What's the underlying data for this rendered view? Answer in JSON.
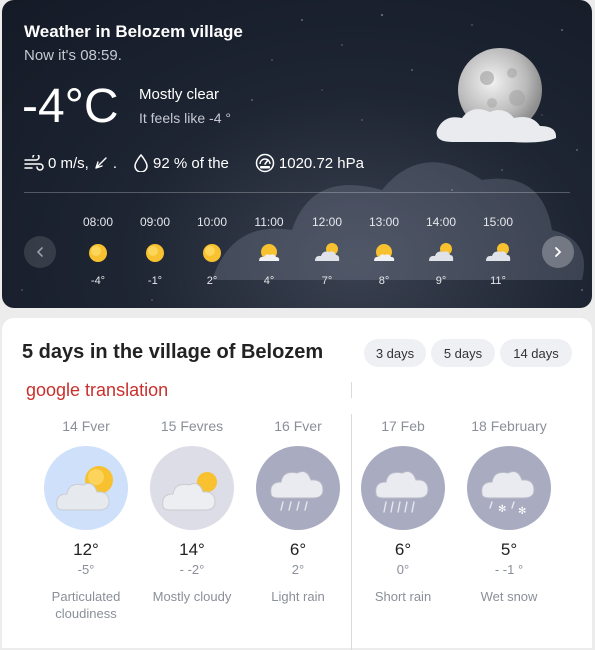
{
  "current": {
    "title": "Weather in Belozem village",
    "time": "Now it's 08:59.",
    "temperature": "-4°C",
    "condition": "Mostly clear",
    "feels_like": "It feels like -4 °",
    "condition_icon": "moon-with-cloud-icon",
    "metrics": {
      "wind": {
        "icon": "wind-icon",
        "value": "0 m/s,",
        "direction_icon": "wind-direction-icon",
        "suffix": "."
      },
      "humidity": {
        "icon": "humidity-icon",
        "value": "92 % of the"
      },
      "pressure": {
        "icon": "pressure-gauge-icon",
        "value": "1020.72 hPa"
      }
    }
  },
  "hourly": [
    {
      "time": "08:00",
      "icon": "sun-icon",
      "temp": "-4°"
    },
    {
      "time": "09:00",
      "icon": "sun-icon",
      "temp": "-1°"
    },
    {
      "time": "10:00",
      "icon": "sun-icon",
      "temp": "2°"
    },
    {
      "time": "11:00",
      "icon": "sun-behind-small-cloud-icon",
      "temp": "4°"
    },
    {
      "time": "12:00",
      "icon": "sun-behind-cloud-icon",
      "temp": "7°"
    },
    {
      "time": "13:00",
      "icon": "sun-behind-small-cloud-icon",
      "temp": "8°"
    },
    {
      "time": "14:00",
      "icon": "sun-behind-cloud-icon",
      "temp": "9°"
    },
    {
      "time": "15:00",
      "icon": "sun-behind-cloud-icon",
      "temp": "11°"
    }
  ],
  "forecast": {
    "title": "5 days in the village of Belozem",
    "ranges": [
      "3 days",
      "5 days",
      "14 days"
    ],
    "translation_note": "google translation",
    "days": [
      {
        "date": "14 Fver",
        "max": "12°",
        "min": "-5°",
        "condition": "Particulated cloudiness",
        "icon": "partly-cloudy-icon"
      },
      {
        "date": "15 Fevres",
        "max": "14°",
        "min": "- -2°",
        "condition": "Mostly cloudy",
        "icon": "mostly-cloudy-icon"
      },
      {
        "date": "16 Fver",
        "max": "6°",
        "min": "2°",
        "condition": "Light rain",
        "icon": "light-rain-icon"
      },
      {
        "date": "17 Feb",
        "max": "6°",
        "min": "0°",
        "condition": "Short rain",
        "icon": "short-rain-icon"
      },
      {
        "date": "18 February",
        "max": "5°",
        "min": "- -1 °",
        "condition": "Wet snow",
        "icon": "wet-snow-icon"
      }
    ]
  },
  "colors": {
    "card_dark": "#1e2533",
    "sun": "#f7c12f",
    "accent_red": "#c9302c",
    "day_circle_partly": "#cfe0fb",
    "day_circle_cloudy": "#dcdde6",
    "day_circle_rain": "#a9abc0"
  }
}
